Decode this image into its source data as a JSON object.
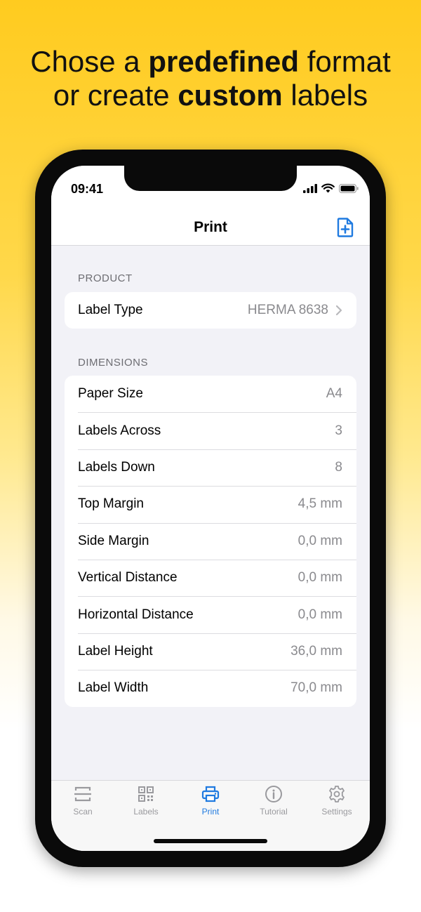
{
  "headline": {
    "line1_pre": "Chose a ",
    "line1_bold": "predefined",
    "line1_post": " format",
    "line2_pre": "or create ",
    "line2_bold": "custom",
    "line2_post": " labels"
  },
  "status_bar": {
    "time": "09:41"
  },
  "nav": {
    "title": "Print",
    "add_icon": "add-document-icon"
  },
  "product": {
    "header": "PRODUCT",
    "label_type": {
      "label": "Label Type",
      "value": "HERMA 8638"
    }
  },
  "dimensions": {
    "header": "DIMENSIONS",
    "rows": [
      {
        "label": "Paper Size",
        "value": "A4"
      },
      {
        "label": "Labels Across",
        "value": "3"
      },
      {
        "label": "Labels Down",
        "value": "8"
      },
      {
        "label": "Top Margin",
        "value": "4,5 mm"
      },
      {
        "label": "Side Margin",
        "value": "0,0 mm"
      },
      {
        "label": "Vertical Distance",
        "value": "0,0 mm"
      },
      {
        "label": "Horizontal Distance",
        "value": "0,0 mm"
      },
      {
        "label": "Label Height",
        "value": "36,0 mm"
      },
      {
        "label": "Label Width",
        "value": "70,0 mm"
      }
    ]
  },
  "tabs": [
    {
      "label": "Scan",
      "icon": "scan-icon",
      "active": false
    },
    {
      "label": "Labels",
      "icon": "qr-code-icon",
      "active": false
    },
    {
      "label": "Print",
      "icon": "printer-icon",
      "active": true
    },
    {
      "label": "Tutorial",
      "icon": "info-icon",
      "active": false
    },
    {
      "label": "Settings",
      "icon": "gear-icon",
      "active": false
    }
  ],
  "colors": {
    "accent": "#1F7AE0",
    "background": "#F2F2F7",
    "banner": "#FFCB1F"
  }
}
